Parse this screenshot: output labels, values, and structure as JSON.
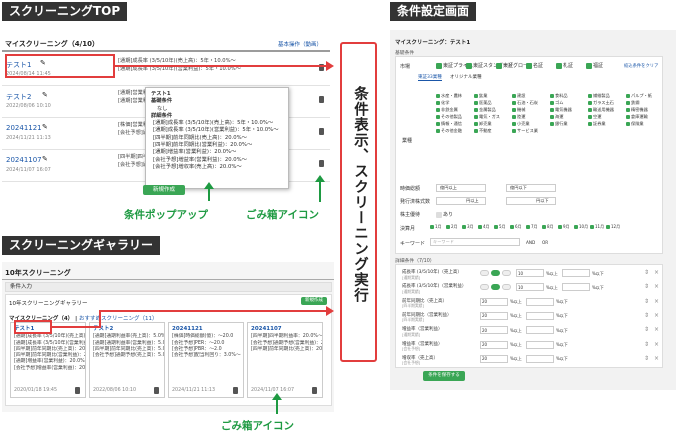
{
  "tags": {
    "top": "スクリーニングTOP",
    "gallery": "スクリーニングギャラリー",
    "settings": "条件設定画面"
  },
  "top": {
    "heading": "マイスクリーニング（4/10）",
    "link": "基本操作（動画）",
    "rows": [
      {
        "title": "テスト1",
        "date": "2024/08/14 11:45",
        "c1": "[通期]成長率 (3/5/10年)(売上高)：5年・10.0%〜",
        "c2": "[通期]成長率 (3/5/10年)(営業利益)：5年・10.0%〜"
      },
      {
        "title": "テスト2",
        "date": "2022/08/06 10:10",
        "c1": "[通期]営業利益 (売上高)：5年・10.0%〜",
        "c2": "[通期]営業利益 (営業利益)：5年・10.0%〜"
      },
      {
        "title": "20241121",
        "date": "2024/11/21 11:13",
        "c1": "[株価]営業利益率：10.0%〜",
        "c2": "[会社予想]通期予想(営業利益)：5年・10.0%〜"
      },
      {
        "title": "20241107",
        "date": "2024/11/07 16:07",
        "c1": "[四半期]四半期利益率：20.0%〜",
        "c2": "[会社予想]通期予想(営業利益)：20.0%〜"
      }
    ],
    "newbtn": "新規作成"
  },
  "popup": {
    "title": "テスト1",
    "h1": "基礎条件",
    "v1": "なし",
    "h2": "詳細条件",
    "lines": [
      "[通期]成長率 (3/5/10年)(売上高)：5年・10.0%〜",
      "[通期]成長率 (3/5/10年)(営業利益)：5年・10.0%〜",
      "[四半期]前年同期比(売上高)：20.0%〜",
      "[四半期]前年同期比(営業利益)：20.0%〜",
      "[通期]増益率(営業利益)：20.0%〜",
      "[会社予想]増益率(営業利益)：20.0%〜",
      "[会社予想]増収率(売上高)：20.0%〜"
    ]
  },
  "labels": {
    "popup": "条件ポップアップ",
    "trash1": "ごみ箱アイコン",
    "trash2": "ごみ箱アイコン",
    "center": "条件表示、スクリーニング実行"
  },
  "gallery": {
    "title": "10年スクリーニング",
    "tab": "条件入力",
    "sub": "10年スクリーニングギャラリー",
    "subbtn": "新規作成",
    "my": "マイスクリーニング（4）",
    "rec": "おすすめスクリーニング（11）",
    "cards": [
      {
        "title": "テスト1",
        "lines": [
          "[通期]成長率 (3/5/10年)(売上高)：5年・",
          "[通期]成長率 (3/5/10年)(営業利益)：5年・",
          "[四半期]前年同期比(売上高)：20.0%〜",
          "[四半期]前年同期比(営業利益)：20.0%〜",
          "[通期]増益率(営業利益)：20.0%〜",
          "[会社予想]増益率(営業利益)：20.0%〜"
        ],
        "date": "2020/01/18 19:45"
      },
      {
        "title": "テスト2",
        "lines": [
          "[通期]通期利益率(売上高)：5.0%〜",
          "[通期]通期利益率(営業利益)：5.0%〜",
          "[四半期]前年同期比(売上高)：5.0%〜",
          "[会社予想]通期予想(売上高)：5.0%〜"
        ],
        "date": "2022/08/06 10:10"
      },
      {
        "title": "20241121",
        "lines": [
          "[株価]時価総額(億)：〜20.0",
          "[会社予想]PER：〜20.0",
          "[会社予想]PBR：〜2.0",
          "[会社予想]配当利回り：3.0%〜"
        ],
        "date": "2024/11/21 11:13"
      },
      {
        "title": "20241107",
        "lines": [
          "[四半期]四半期利益率：20.0%〜",
          "[会社予想]通期予想(営業利益)：20.0%〜",
          "[四半期]前年同期比(売上高)：20.0%〜"
        ],
        "date": "2024/11/07 16:07"
      }
    ]
  },
  "settings": {
    "title": "マイスクリーニング：テスト1",
    "sec1": "基礎条件",
    "market": "市場",
    "markets": [
      "東証プライム",
      "東証スタンダード",
      "東証グロース",
      "名証",
      "札証",
      "福証"
    ],
    "marketlink": "絞込条件をクリア",
    "tabs": [
      "東証33業種",
      "オリジナル業種"
    ],
    "industry": "業種",
    "inds": [
      [
        "水産・農林",
        "鉱業",
        "建設",
        "食料品",
        "繊維製品",
        "パルプ・紙"
      ],
      [
        "化学",
        "医薬品",
        "石油・石炭",
        "ゴム",
        "ガラス土石",
        "鉄鋼"
      ],
      [
        "非鉄金属",
        "金属製品",
        "機械",
        "電気機器",
        "輸送用機器",
        "精密機器"
      ],
      [
        "その他製品",
        "電気・ガス",
        "陸運",
        "海運",
        "空運",
        "倉庫運輸"
      ],
      [
        "情報・通信",
        "卸売業",
        "小売業",
        "銀行業",
        "証券業",
        "保険業"
      ],
      [
        "その他金融",
        "不動産",
        "サービス業",
        "",
        "",
        ""
      ]
    ],
    "fields": [
      "時価総額",
      "発行済株式数",
      "株主優待"
    ],
    "f1": [
      "億円以上",
      "億円以下"
    ],
    "f2": [
      "円以上",
      "円以下"
    ],
    "f3": "あり",
    "month": "決算月",
    "months": [
      "1月",
      "2月",
      "3月",
      "4月",
      "5月",
      "6月",
      "7月",
      "8月",
      "9月",
      "10月",
      "11月",
      "12月"
    ],
    "keyword": "キーワード",
    "kwph": "キーワード",
    "kwopt": [
      "AND",
      "OR"
    ],
    "sec2": "詳細条件（7/10）",
    "conds": [
      {
        "n": "成長率 (3/5/10年)（売上高）",
        "s": "[通期実績]",
        "a": "5年",
        "v": "10",
        "u1": "%以上",
        "u2": "%以下"
      },
      {
        "n": "成長率 (3/5/10年)（営業利益）",
        "s": "[通期実績]",
        "a": "5年",
        "v": "10",
        "u1": "%以上",
        "u2": "%以下"
      },
      {
        "n": "前年同期比（売上高）",
        "s": "[四半期実績]",
        "a": "",
        "v": "20",
        "u1": "%以上",
        "u2": "%以下"
      },
      {
        "n": "前年同期比（営業利益）",
        "s": "[四半期実績]",
        "a": "",
        "v": "20",
        "u1": "%以上",
        "u2": "%以下"
      },
      {
        "n": "増益率（営業利益）",
        "s": "[通期実績]",
        "a": "",
        "v": "20",
        "u1": "%以上",
        "u2": "%以下"
      },
      {
        "n": "増益率（営業利益）",
        "s": "[会社予想]",
        "a": "",
        "v": "20",
        "u1": "%以上",
        "u2": "%以下"
      },
      {
        "n": "増収率（売上高）",
        "s": "[会社予想]",
        "a": "",
        "v": "20",
        "u1": "%以上",
        "u2": "%以下"
      }
    ],
    "save": "条件を保存する"
  }
}
